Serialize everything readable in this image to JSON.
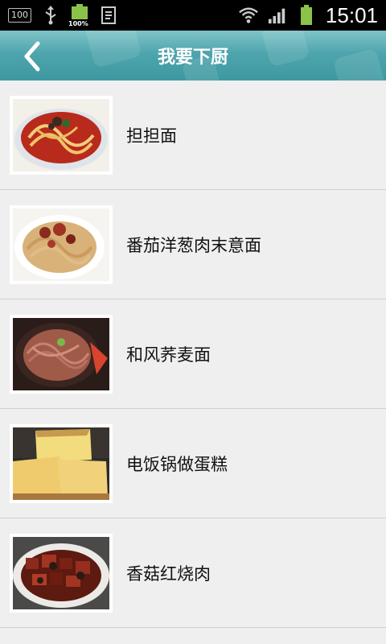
{
  "status_bar": {
    "battery_small": "100",
    "battery_percent": "100%",
    "time": "15:01"
  },
  "header": {
    "title": "我要下厨"
  },
  "recipes": [
    {
      "name": "担担面"
    },
    {
      "name": "番茄洋葱肉末意面"
    },
    {
      "name": "和风荞麦面"
    },
    {
      "name": "电饭锅做蛋糕"
    },
    {
      "name": "香菇红烧肉"
    }
  ],
  "colors": {
    "header_accent": "#4ea5ad",
    "list_background": "#efefef",
    "divider": "#d0d0d0"
  }
}
